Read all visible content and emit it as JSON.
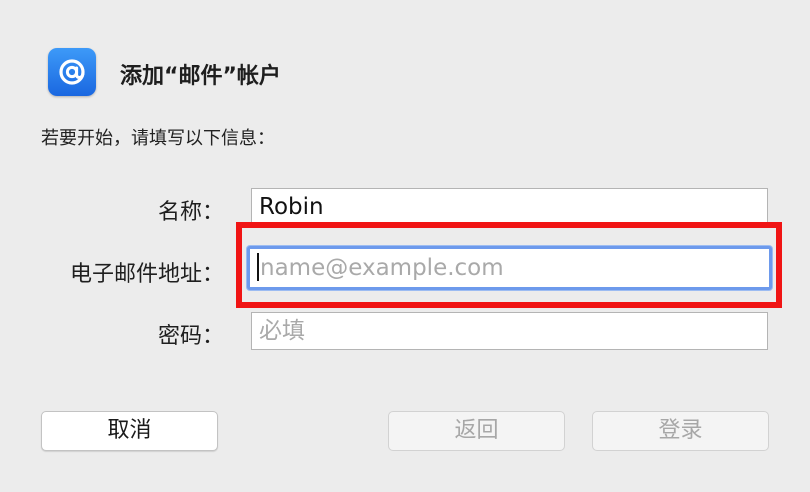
{
  "dialog": {
    "title": "添加“邮件”帐户",
    "instruction": "若要开始，请填写以下信息：",
    "app_icon": "at-sign-icon",
    "accent_color": "#1a67e0"
  },
  "fields": {
    "name": {
      "label": "名称：",
      "value": "Robin"
    },
    "email": {
      "label": "电子邮件地址：",
      "value": "",
      "placeholder": "name@example.com",
      "focused": true
    },
    "password": {
      "label": "密码：",
      "value": "",
      "placeholder": "必填"
    }
  },
  "buttons": {
    "cancel": "取消",
    "back": "返回",
    "login": "登录"
  },
  "highlight": {
    "color": "#f01414",
    "target": "email-field"
  }
}
